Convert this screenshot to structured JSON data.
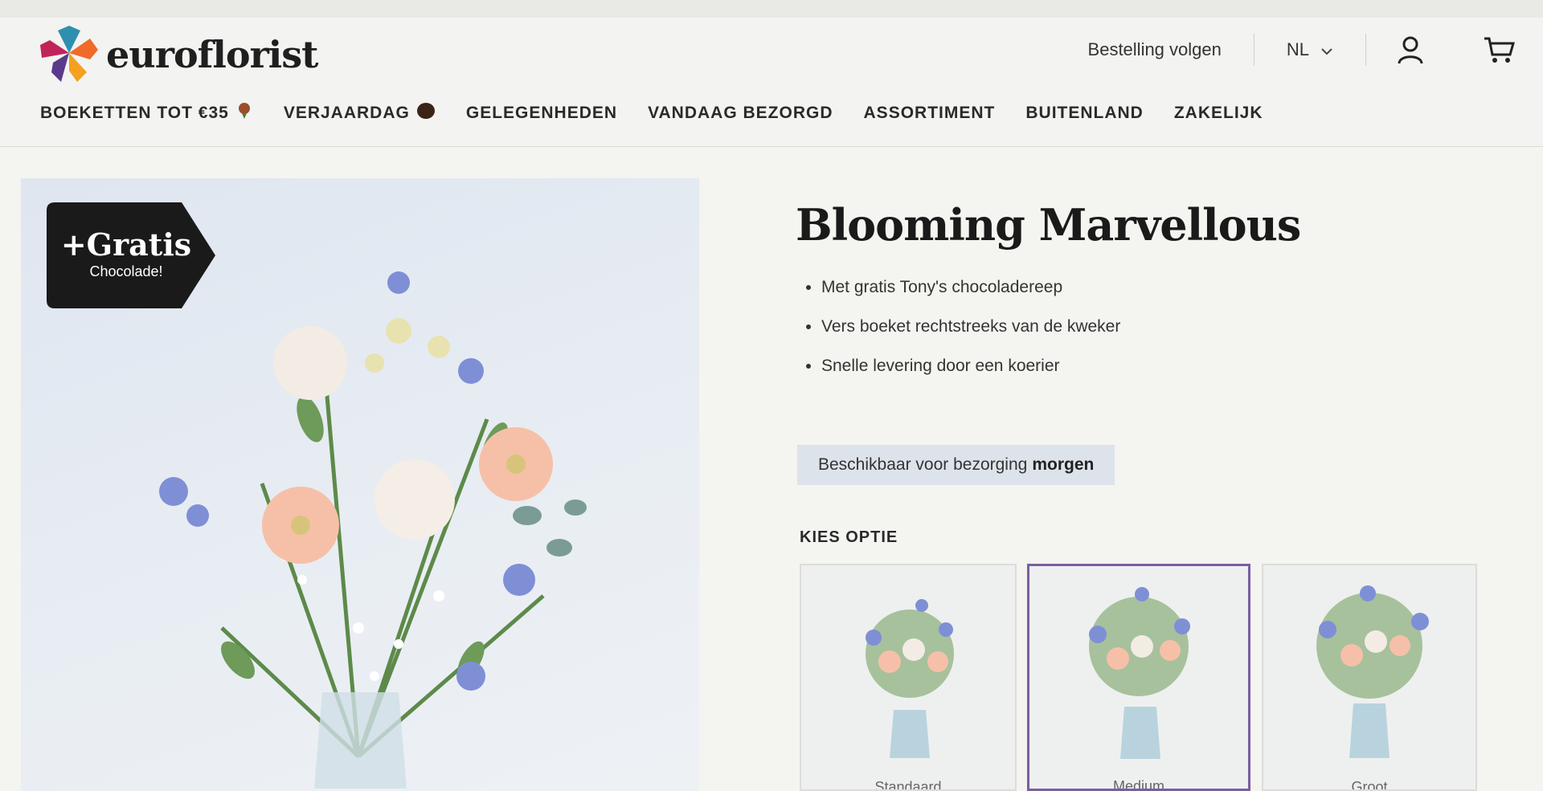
{
  "brand": {
    "name": "euroflorist"
  },
  "header": {
    "track_order": "Bestelling volgen",
    "language": "NL"
  },
  "nav": [
    {
      "label": "BOEKETTEN TOT €35"
    },
    {
      "label": "VERJAARDAG"
    },
    {
      "label": "GELEGENHEDEN"
    },
    {
      "label": "VANDAAG BEZORGD"
    },
    {
      "label": "ASSORTIMENT"
    },
    {
      "label": "BUITENLAND"
    },
    {
      "label": "ZAKELIJK"
    }
  ],
  "product": {
    "badge_title": "+Gratis",
    "badge_subtitle": "Chocolade!",
    "title": "Blooming Marvellous",
    "bullets": [
      "Met gratis Tony's chocoladereep",
      "Vers boeket rechtstreeks van de kweker",
      "Snelle levering door een koerier"
    ],
    "availability_text": "Beschikbaar voor bezorging",
    "availability_day": "morgen",
    "options_title": "KIES OPTIE",
    "options": [
      {
        "label": "Standaard",
        "selected": false
      },
      {
        "label": "Medium",
        "selected": true
      },
      {
        "label": "Groot",
        "selected": false
      }
    ]
  },
  "colors": {
    "selected_border": "#7a5fa0",
    "badge_bg": "#1a1a1a"
  }
}
